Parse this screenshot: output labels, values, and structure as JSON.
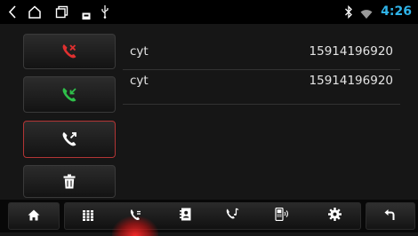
{
  "status_bar": {
    "time": "4:26",
    "colors": {
      "time": "#2fb3e8",
      "icons": "#ffffff"
    },
    "icons": [
      "back-icon",
      "home-icon",
      "recent-apps-icon",
      "screenshot-icon",
      "usb-icon",
      "bluetooth-icon",
      "wifi-icon"
    ]
  },
  "side_buttons": [
    {
      "name": "missed-calls-button",
      "icon": "missed-call-icon",
      "color": "#e03030"
    },
    {
      "name": "received-calls-button",
      "icon": "received-call-icon",
      "color": "#2fbf4a"
    },
    {
      "name": "dialed-calls-button",
      "icon": "dialed-call-icon",
      "color": "#ffffff",
      "selected": true
    },
    {
      "name": "delete-button",
      "icon": "trash-icon",
      "color": "#ffffff"
    }
  ],
  "call_log": [
    {
      "name": "cyt",
      "number": "15914196920"
    },
    {
      "name": "cyt",
      "number": "15914196920"
    }
  ],
  "nav": {
    "items": [
      "home-icon",
      "dialpad-icon",
      "call-log-icon",
      "contacts-icon",
      "music-icon",
      "phone-device-icon",
      "settings-icon",
      "return-icon"
    ],
    "active": "call-log-icon",
    "accent": "#ff2a2a"
  }
}
